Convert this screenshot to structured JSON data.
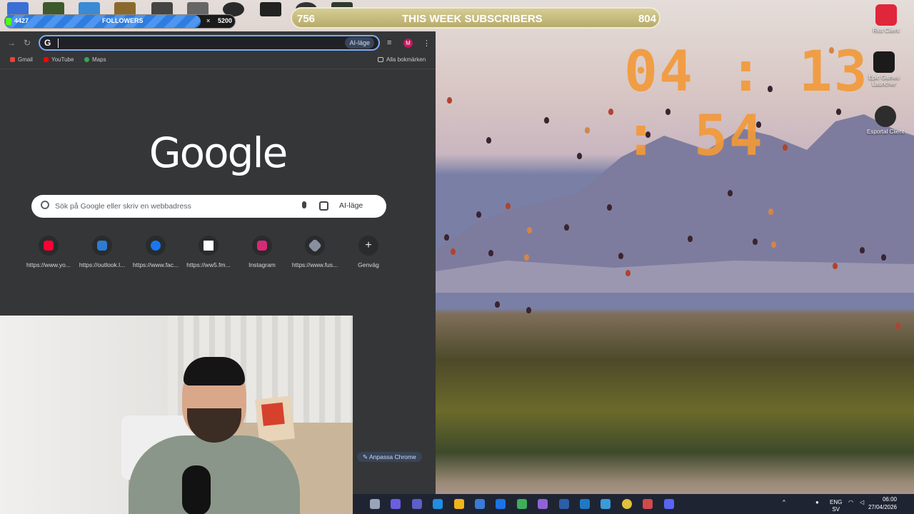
{
  "overlay": {
    "followers": {
      "current": "4427",
      "label": "FOLLOWERS",
      "close_glyph": "×",
      "goal": "5200",
      "progress_fraction": 0.85
    },
    "subscribers": {
      "left_value": "756",
      "title": "THIS WEEK SUBSCRIBERS",
      "right_value": "804"
    },
    "clock": "04 : 13 : 54"
  },
  "desktop_icons": [
    {
      "label": "Riot Client",
      "icon": "riot-client-icon"
    },
    {
      "label": "Epic Games Launcher",
      "icon": "epic-games-icon"
    },
    {
      "label": "Esportal Client",
      "icon": "esportal-icon"
    }
  ],
  "chrome": {
    "omnibox": {
      "value": "",
      "google_glyph": "G",
      "ai_mode_label": "AI-läge"
    },
    "profile_initial": "M",
    "bookmarks": [
      {
        "label": "Gmail",
        "color": "#ea4335"
      },
      {
        "label": "YouTube",
        "color": "#ff0000"
      },
      {
        "label": "Maps",
        "color": "#34a853"
      }
    ],
    "all_bookmarks_label": "Alla bokmärken",
    "logo_text": "Google",
    "search": {
      "placeholder": "Sök på Google eller skriv en webbadress",
      "ai_mode_label": "AI-läge"
    },
    "shortcuts": [
      {
        "label": "https://www.yo...",
        "icon": "youtube-icon",
        "color": "#ff0033"
      },
      {
        "label": "https://outlook.l...",
        "icon": "outlook-icon",
        "color": "#2b7cd3"
      },
      {
        "label": "https://www.fac...",
        "icon": "facebook-icon",
        "color": "#1877f2"
      },
      {
        "label": "https://ww5.fm...",
        "icon": "page-icon",
        "color": "#ffffff"
      },
      {
        "label": "Instagram",
        "icon": "instagram-icon",
        "color": "#d62976"
      },
      {
        "label": "https://www.fus...",
        "icon": "fusion-icon",
        "color": "#8a8fa0"
      },
      {
        "label": "Genväg",
        "icon": "plus-icon",
        "color": "#2a2b2d"
      }
    ],
    "customize_label": "Anpassa Chrome"
  },
  "taskbar": {
    "apps": [
      "file-explorer-icon",
      "copilot-icon",
      "teams-icon",
      "edge-icon",
      "folder-icon",
      "store-icon",
      "outlook-icon",
      "shield-icon",
      "microsoft365-icon",
      "vpn-icon",
      "mail-icon",
      "image-icon",
      "chrome-icon",
      "riot-icon",
      "discord-icon"
    ],
    "lang_top": "ENG",
    "lang_bottom": "SV",
    "time": "06:00",
    "date": "27/04/2026"
  }
}
